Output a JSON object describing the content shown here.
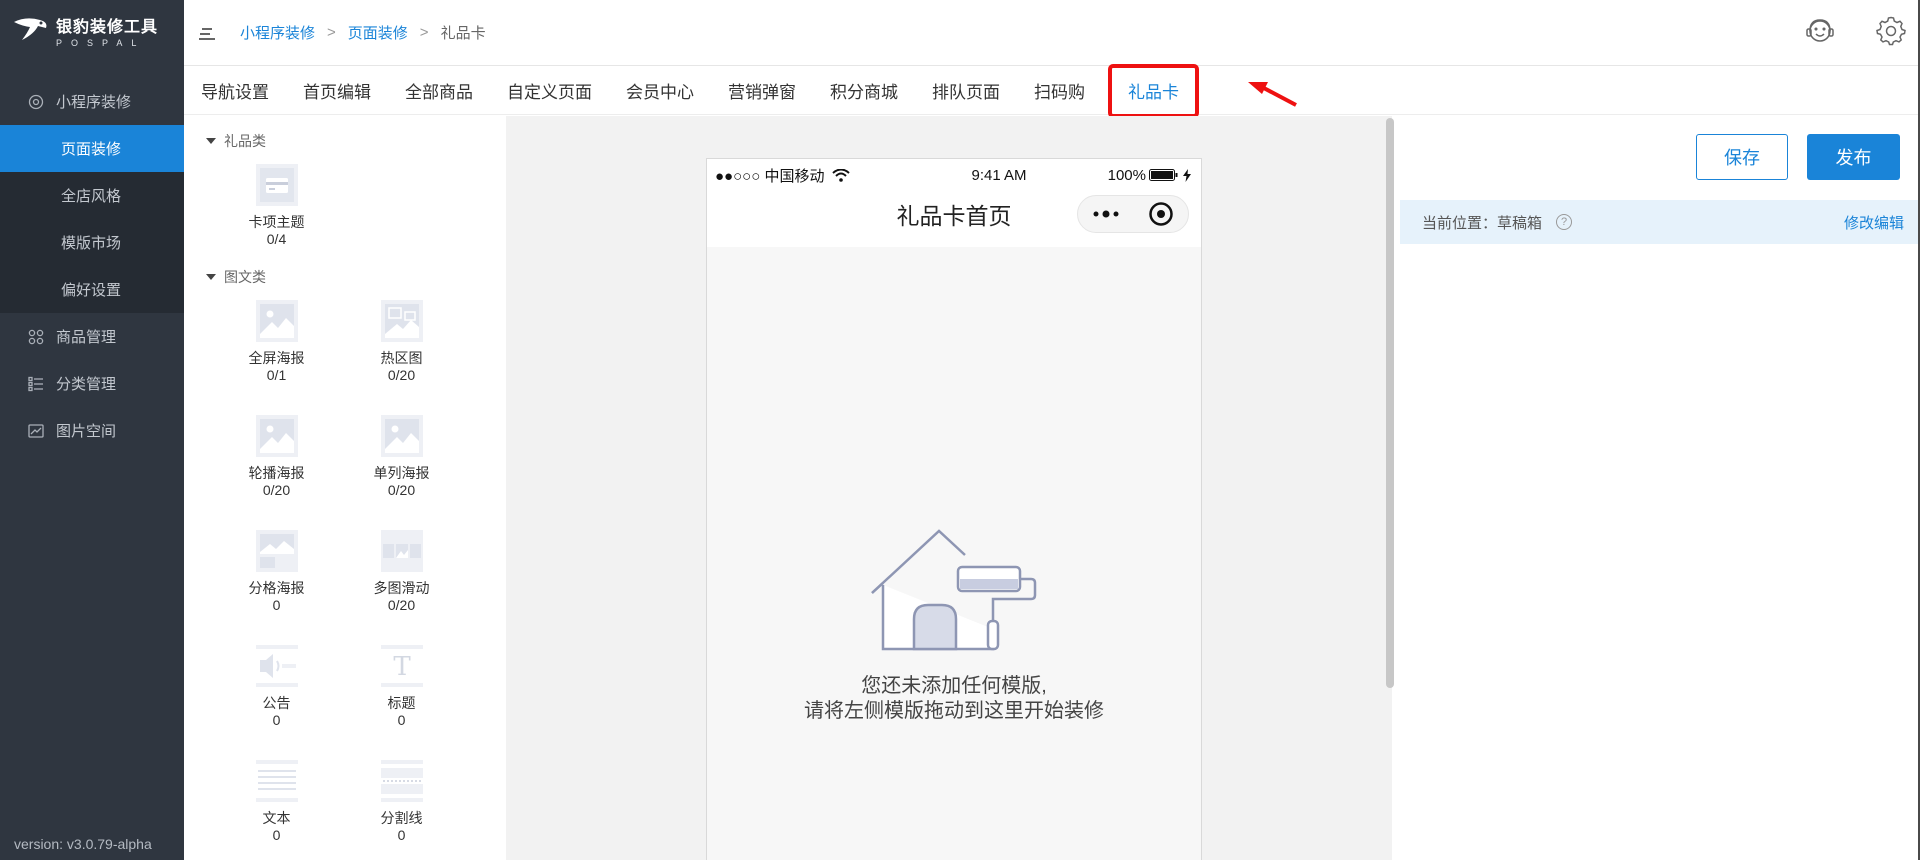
{
  "app": {
    "logo_cn": "银豹装修工具",
    "logo_en": "POSPAL",
    "version": "version: v3.0.79-alpha"
  },
  "sidebar": {
    "groups": [
      {
        "label": "小程序装修",
        "icon": "target-icon"
      },
      {
        "label": "商品管理",
        "icon": "grid-icon"
      },
      {
        "label": "分类管理",
        "icon": "list-icon"
      },
      {
        "label": "图片空间",
        "icon": "image-icon"
      }
    ],
    "sub_items": [
      {
        "label": "页面装修",
        "active": true
      },
      {
        "label": "全店风格",
        "active": false
      },
      {
        "label": "模版市场",
        "active": false
      },
      {
        "label": "偏好设置",
        "active": false
      }
    ]
  },
  "breadcrumb": {
    "items": [
      "小程序装修",
      "页面装修"
    ],
    "separator": ">",
    "current": "礼品卡"
  },
  "tabs": [
    {
      "label": "导航设置"
    },
    {
      "label": "首页编辑"
    },
    {
      "label": "全部商品"
    },
    {
      "label": "自定义页面"
    },
    {
      "label": "会员中心"
    },
    {
      "label": "营销弹窗"
    },
    {
      "label": "积分商城"
    },
    {
      "label": "排队页面"
    },
    {
      "label": "扫码购"
    },
    {
      "label": "礼品卡",
      "active": true
    }
  ],
  "widgets": {
    "categories": [
      {
        "label": "礼品类",
        "items": [
          {
            "name": "卡项主题",
            "count": "0/4",
            "icon": "card-icon"
          }
        ]
      },
      {
        "label": "图文类",
        "items": [
          {
            "name": "全屏海报",
            "count": "0/1",
            "icon": "image-icon"
          },
          {
            "name": "热区图",
            "count": "0/20",
            "icon": "hotspot-image-icon"
          },
          {
            "name": "轮播海报",
            "count": "0/20",
            "icon": "image-icon"
          },
          {
            "name": "单列海报",
            "count": "0/20",
            "icon": "image-icon"
          },
          {
            "name": "分格海报",
            "count": "0",
            "icon": "grid-poster-icon"
          },
          {
            "name": "多图滑动",
            "count": "0/20",
            "icon": "multi-image-icon"
          },
          {
            "name": "公告",
            "count": "0",
            "icon": "speaker-icon"
          },
          {
            "name": "标题",
            "count": "0",
            "icon": "title-t-icon"
          },
          {
            "name": "文本",
            "count": "0",
            "icon": "text-lines-icon"
          },
          {
            "name": "分割线",
            "count": "0",
            "icon": "divider-icon"
          }
        ]
      }
    ]
  },
  "phone": {
    "carrier": "●●○○○ 中国移动",
    "time": "9:41 AM",
    "battery": "100%",
    "title": "礼品卡首页",
    "empty_line1": "您还未添加任何模版,",
    "empty_line2": "请将左侧模版拖动到这里开始装修"
  },
  "right_panel": {
    "save_label": "保存",
    "publish_label": "发布",
    "location_label": "当前位置：草稿箱",
    "help_label": "?",
    "edit_label": "修改编辑"
  },
  "colors": {
    "accent": "#1a84d8",
    "sidebar_bg": "#2f3640",
    "highlight": "#ee1111"
  }
}
